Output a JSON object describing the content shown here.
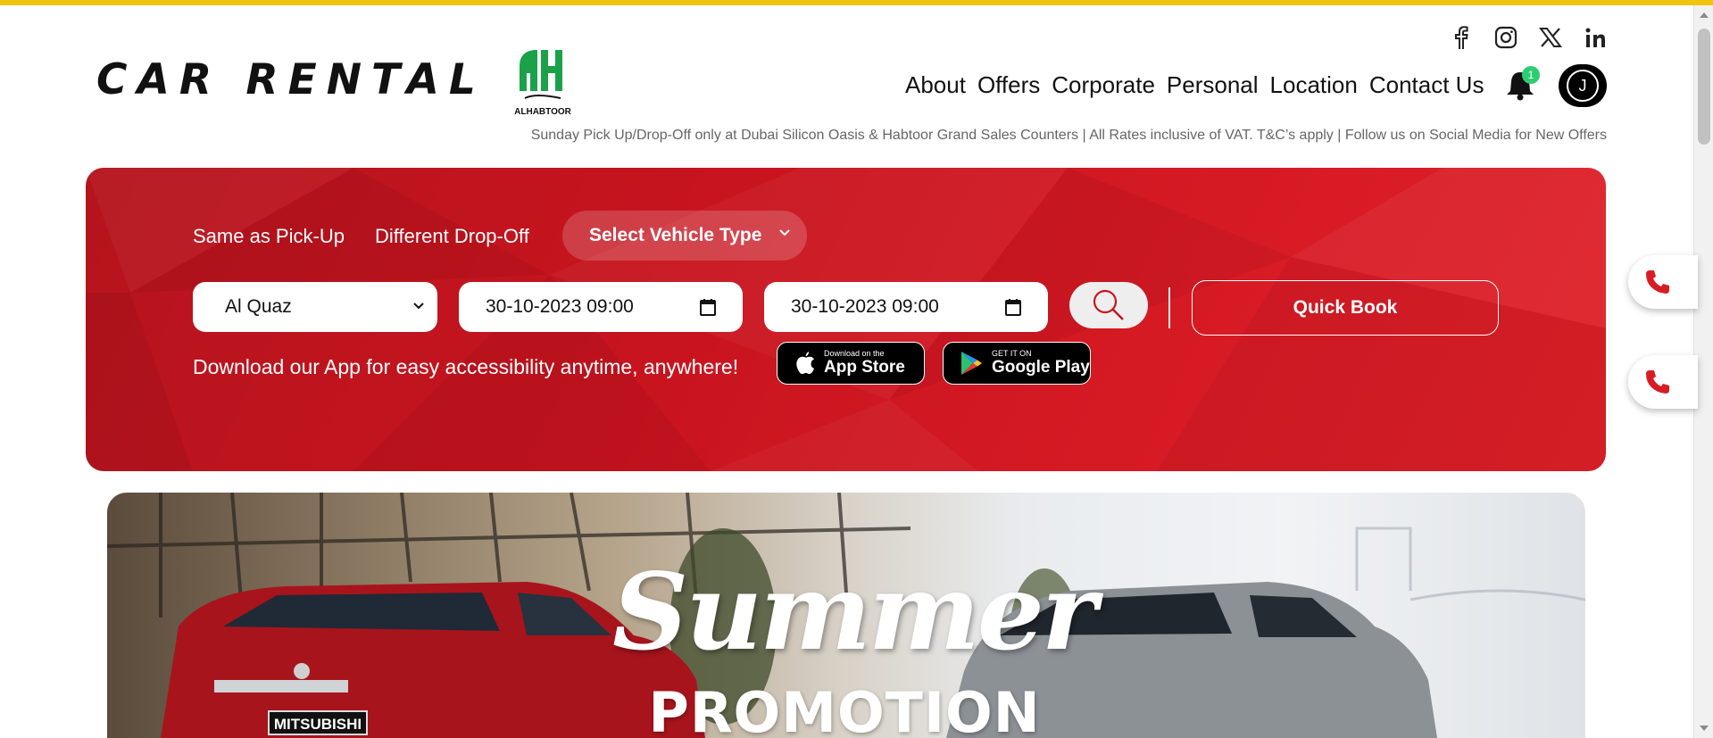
{
  "header": {
    "logo_text": "CAR RENTAL",
    "brand_caption": "ALHABTOOR",
    "social_icons": [
      "facebook-icon",
      "instagram-icon",
      "x-icon",
      "linkedin-icon"
    ],
    "nav": [
      "About",
      "Offers",
      "Corporate",
      "Personal",
      "Location",
      "Contact Us"
    ],
    "notification_count": "1",
    "avatar_initial": "J",
    "notice": "Sunday Pick Up/Drop-Off only at Dubai Silicon Oasis & Habtoor Grand Sales Counters | All Rates inclusive of VAT. T&C’s apply | Follow us on Social Media for New Offers"
  },
  "booking": {
    "option_same": "Same as Pick-Up",
    "option_different": "Different Drop-Off",
    "vehicle_type": "Select Vehicle Type",
    "location": "Al Quaz",
    "pickup_datetime": "30-10-2023 09:00",
    "dropoff_datetime": "30-10-2023 09:00",
    "quick_book": "Quick Book",
    "app_text": "Download our App for easy accessibility anytime, anywhere!",
    "app_store_small": "Download on the",
    "app_store_big": "App Store",
    "google_small": "GET IT ON",
    "google_big": "Google Play"
  },
  "banner": {
    "title": "Summer",
    "subtitle": "PROMOTION",
    "plate": "MITSUBISHI"
  },
  "colors": {
    "accent": "#c8141f",
    "top_strip": "#f1c40f",
    "brand_green": "#1aa14a",
    "badge": "#2ecc71"
  }
}
